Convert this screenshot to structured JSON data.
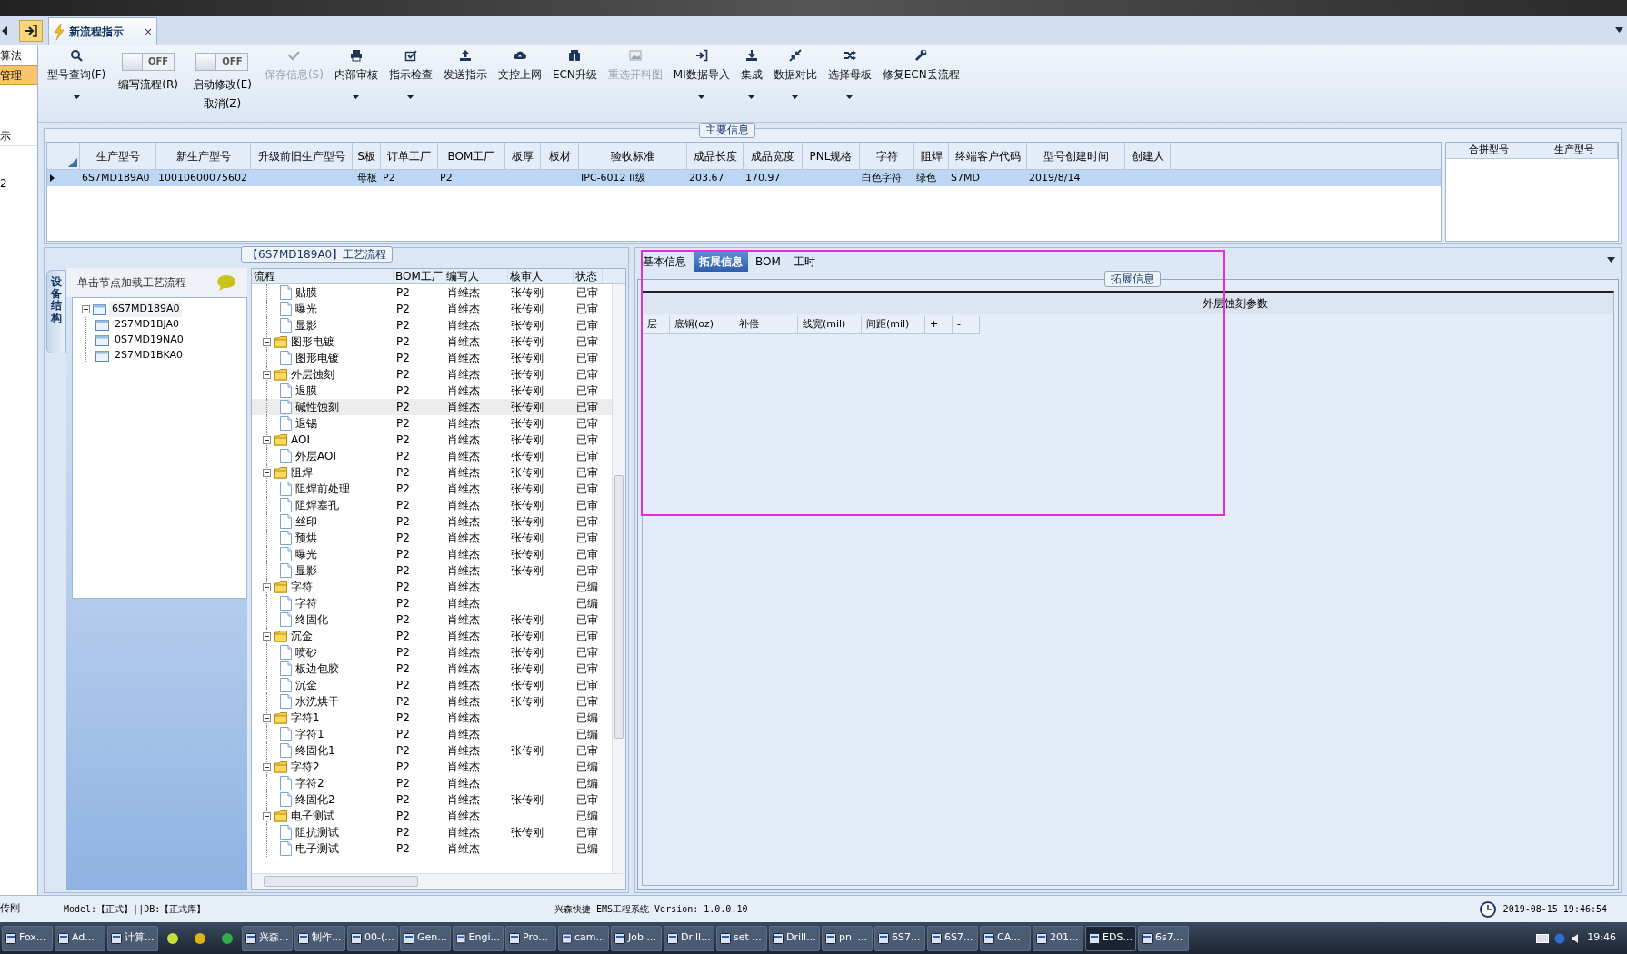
{
  "sidebar": {
    "items": [
      {
        "label": "算法",
        "selected": false
      },
      {
        "label": "管理",
        "selected": true
      },
      {
        "label": "示",
        "selected": false
      },
      {
        "label": "2",
        "selected": false
      }
    ]
  },
  "document_tab": {
    "title": "新流程指示",
    "close": "×"
  },
  "toolbar": {
    "items": [
      {
        "kind": "button",
        "label": "型号查询(F)",
        "dropdown": true,
        "disabled": false
      },
      {
        "kind": "toggle",
        "label": "编写流程(R)",
        "switch_text": "OFF",
        "on": false
      },
      {
        "kind": "toggle",
        "label": "启动修改(E)",
        "label2": "取消(Z)",
        "switch_text": "OFF",
        "on": false
      },
      {
        "kind": "button",
        "label": "保存信息(S)",
        "dropdown": false,
        "disabled": true
      },
      {
        "kind": "button",
        "label": "内部审核",
        "dropdown": true,
        "disabled": false
      },
      {
        "kind": "button",
        "label": "指示检查",
        "dropdown": true,
        "disabled": false
      },
      {
        "kind": "button",
        "label": "发送指示",
        "dropdown": false,
        "disabled": false
      },
      {
        "kind": "button",
        "label": "文控上网",
        "dropdown": false,
        "disabled": false
      },
      {
        "kind": "button",
        "label": "ECN升级",
        "dropdown": false,
        "disabled": false
      },
      {
        "kind": "button",
        "label": "重选开料图",
        "dropdown": false,
        "disabled": true
      },
      {
        "kind": "button",
        "label": "MI数据导入",
        "dropdown": true,
        "disabled": false
      },
      {
        "kind": "button",
        "label": "集成",
        "dropdown": true,
        "disabled": false
      },
      {
        "kind": "button",
        "label": "数据对比",
        "dropdown": true,
        "disabled": false
      },
      {
        "kind": "button",
        "label": "选择母板",
        "dropdown": true,
        "disabled": false
      },
      {
        "kind": "button",
        "label": "修复ECN丢流程",
        "dropdown": false,
        "disabled": false
      }
    ]
  },
  "main_info": {
    "title": "主要信息",
    "table": {
      "columns": [
        "生产型号",
        "新生产型号",
        "升级前旧生产型号",
        "S板",
        "订单工厂",
        "BOM工厂",
        "板厚",
        "板材",
        "验收标准",
        "成品长度",
        "成品宽度",
        "PNL规格",
        "字符",
        "阻焊",
        "终端客户代码",
        "型号创建时间",
        "创建人"
      ],
      "rows": [
        {
          "selected": true,
          "cells": [
            "6S7MD189A0",
            "10010600075602",
            null,
            "母板",
            "P2",
            "P2",
            null,
            null,
            "IPC-6012 II级",
            "203.67",
            "170.97",
            null,
            "白色字符",
            "绿色",
            "S7MD",
            "2019/8/14",
            null
          ]
        }
      ]
    },
    "side_table": {
      "columns": [
        "合拼型号",
        "生产型号"
      ]
    }
  },
  "structure_panel": {
    "vertical_tab": "设备结构",
    "hint": "单击节点加载工艺流程",
    "tree": [
      {
        "label": "6S7MD189A0",
        "expanded": true,
        "children": [
          {
            "label": "2S7MD1BJA0"
          },
          {
            "label": "0S7MD19NA0"
          },
          {
            "label": "2S7MD1BKA0"
          }
        ]
      }
    ]
  },
  "process_flow": {
    "title": "【6S7MD189A0】工艺流程",
    "columns": [
      "流程",
      "BOM工厂",
      "编写人",
      "核审人",
      "状态"
    ],
    "rows": [
      {
        "kind": "step",
        "name": "贴膜",
        "bom_factory": "P2",
        "writer": "肖维杰",
        "reviewer": "张传刚",
        "status": "已审",
        "selected": false
      },
      {
        "kind": "step",
        "name": "曝光",
        "bom_factory": "P2",
        "writer": "肖维杰",
        "reviewer": "张传刚",
        "status": "已审",
        "selected": false
      },
      {
        "kind": "step",
        "name": "显影",
        "bom_factory": "P2",
        "writer": "肖维杰",
        "reviewer": "张传刚",
        "status": "已审",
        "selected": false
      },
      {
        "kind": "folder",
        "name": "图形电镀",
        "bom_factory": "P2",
        "writer": "肖维杰",
        "reviewer": "张传刚",
        "status": "已审",
        "selected": false,
        "expanded": true,
        "children": [
          {
            "kind": "step",
            "name": "图形电镀",
            "bom_factory": "P2",
            "writer": "肖维杰",
            "reviewer": "张传刚",
            "status": "已审",
            "selected": false
          }
        ]
      },
      {
        "kind": "folder",
        "name": "外层蚀刻",
        "bom_factory": "P2",
        "writer": "肖维杰",
        "reviewer": "张传刚",
        "status": "已审",
        "selected": false,
        "expanded": true,
        "children": [
          {
            "kind": "step",
            "name": "退膜",
            "bom_factory": "P2",
            "writer": "肖维杰",
            "reviewer": "张传刚",
            "status": "已审",
            "selected": false
          },
          {
            "kind": "step",
            "name": "碱性蚀刻",
            "bom_factory": "P2",
            "writer": "肖维杰",
            "reviewer": "张传刚",
            "status": "已审",
            "selected": true
          },
          {
            "kind": "step",
            "name": "退锡",
            "bom_factory": "P2",
            "writer": "肖维杰",
            "reviewer": "张传刚",
            "status": "已审",
            "selected": false
          }
        ]
      },
      {
        "kind": "folder",
        "name": "AOI",
        "bom_factory": "P2",
        "writer": "肖维杰",
        "reviewer": "张传刚",
        "status": "已审",
        "selected": false,
        "expanded": true,
        "children": [
          {
            "kind": "step",
            "name": "外层AOI",
            "bom_factory": "P2",
            "writer": "肖维杰",
            "reviewer": "张传刚",
            "status": "已审",
            "selected": false
          }
        ]
      },
      {
        "kind": "folder",
        "name": "阻焊",
        "bom_factory": "P2",
        "writer": "肖维杰",
        "reviewer": "张传刚",
        "status": "已审",
        "selected": false,
        "expanded": true,
        "children": [
          {
            "kind": "step",
            "name": "阻焊前处理",
            "bom_factory": "P2",
            "writer": "肖维杰",
            "reviewer": "张传刚",
            "status": "已审",
            "selected": false
          },
          {
            "kind": "step",
            "name": "阻焊塞孔",
            "bom_factory": "P2",
            "writer": "肖维杰",
            "reviewer": "张传刚",
            "status": "已审",
            "selected": false
          },
          {
            "kind": "step",
            "name": "丝印",
            "bom_factory": "P2",
            "writer": "肖维杰",
            "reviewer": "张传刚",
            "status": "已审",
            "selected": false
          },
          {
            "kind": "step",
            "name": "预烘",
            "bom_factory": "P2",
            "writer": "肖维杰",
            "reviewer": "张传刚",
            "status": "已审",
            "selected": false
          },
          {
            "kind": "step",
            "name": "曝光",
            "bom_factory": "P2",
            "writer": "肖维杰",
            "reviewer": "张传刚",
            "status": "已审",
            "selected": false
          },
          {
            "kind": "step",
            "name": "显影",
            "bom_factory": "P2",
            "writer": "肖维杰",
            "reviewer": "张传刚",
            "status": "已审",
            "selected": false
          }
        ]
      },
      {
        "kind": "folder",
        "name": "字符",
        "bom_factory": "P2",
        "writer": "肖维杰",
        "status": "已编",
        "selected": false,
        "expanded": true,
        "children": [
          {
            "kind": "step",
            "name": "字符",
            "bom_factory": "P2",
            "writer": "肖维杰",
            "status": "已编",
            "selected": false
          },
          {
            "kind": "step",
            "name": "终固化",
            "bom_factory": "P2",
            "writer": "肖维杰",
            "reviewer": "张传刚",
            "status": "已审",
            "selected": false
          }
        ]
      },
      {
        "kind": "folder",
        "name": "沉金",
        "bom_factory": "P2",
        "writer": "肖维杰",
        "reviewer": "张传刚",
        "status": "已审",
        "selected": false,
        "expanded": true,
        "children": [
          {
            "kind": "step",
            "name": "喷砂",
            "bom_factory": "P2",
            "writer": "肖维杰",
            "reviewer": "张传刚",
            "status": "已审",
            "selected": false
          },
          {
            "kind": "step",
            "name": "板边包胶",
            "bom_factory": "P2",
            "writer": "肖维杰",
            "reviewer": "张传刚",
            "status": "已审",
            "selected": false
          },
          {
            "kind": "step",
            "name": "沉金",
            "bom_factory": "P2",
            "writer": "肖维杰",
            "reviewer": "张传刚",
            "status": "已审",
            "selected": false
          },
          {
            "kind": "step",
            "name": "水洗烘干",
            "bom_factory": "P2",
            "writer": "肖维杰",
            "reviewer": "张传刚",
            "status": "已审",
            "selected": false
          }
        ]
      },
      {
        "kind": "folder",
        "name": "字符1",
        "bom_factory": "P2",
        "writer": "肖维杰",
        "status": "已编",
        "selected": false,
        "expanded": true,
        "children": [
          {
            "kind": "step",
            "name": "字符1",
            "bom_factory": "P2",
            "writer": "肖维杰",
            "status": "已编",
            "selected": false
          },
          {
            "kind": "step",
            "name": "终固化1",
            "bom_factory": "P2",
            "writer": "肖维杰",
            "reviewer": "张传刚",
            "status": "已审",
            "selected": false
          }
        ]
      },
      {
        "kind": "folder",
        "name": "字符2",
        "bom_factory": "P2",
        "writer": "肖维杰",
        "status": "已编",
        "selected": false,
        "expanded": true,
        "children": [
          {
            "kind": "step",
            "name": "字符2",
            "bom_factory": "P2",
            "writer": "肖维杰",
            "status": "已编",
            "selected": false
          },
          {
            "kind": "step",
            "name": "终固化2",
            "bom_factory": "P2",
            "writer": "肖维杰",
            "reviewer": "张传刚",
            "status": "已审",
            "selected": false
          }
        ]
      },
      {
        "kind": "folder",
        "name": "电子测试",
        "bom_factory": "P2",
        "writer": "肖维杰",
        "status": "已编",
        "selected": false,
        "expanded": true,
        "children": [
          {
            "kind": "step",
            "name": "阻抗测试",
            "bom_factory": "P2",
            "writer": "肖维杰",
            "reviewer": "张传刚",
            "status": "已审",
            "selected": false
          },
          {
            "kind": "step",
            "name": "电子测试",
            "bom_factory": "P2",
            "writer": "肖维杰",
            "status": "已编",
            "selected": false
          }
        ]
      }
    ]
  },
  "detail_panel": {
    "tabs": [
      {
        "label": "基本信息",
        "selected": false
      },
      {
        "label": "拓展信息",
        "selected": true
      },
      {
        "label": "BOM",
        "selected": false
      },
      {
        "label": "工时",
        "selected": false
      }
    ],
    "group_title": "拓展信息",
    "grid_title": "外层蚀刻参数",
    "columns": [
      "层",
      "底铜(oz)",
      "补偿",
      "线宽(mil)",
      "间距(mil)",
      "+",
      "-"
    ]
  },
  "status_bar": {
    "user": "传刚",
    "model": "Model:【正式】||DB:【正式库】",
    "app": "兴森快捷 EMS工程系统 Version: 1.0.0.10",
    "datetime": "2019-08-15 19:46:54"
  },
  "taskbar": {
    "items": [
      {
        "kind": "app",
        "label": "Fox...",
        "selected": false
      },
      {
        "kind": "app",
        "label": "Ad...",
        "selected": false
      },
      {
        "kind": "app",
        "label": "计算...",
        "selected": false
      },
      {
        "kind": "icon_only",
        "selected": false
      },
      {
        "kind": "icon_only",
        "selected": false
      },
      {
        "kind": "icon_only",
        "selected": false
      },
      {
        "kind": "app",
        "label": "兴森...",
        "selected": false
      },
      {
        "kind": "app",
        "label": "制作...",
        "selected": false
      },
      {
        "kind": "app",
        "label": "00-(...",
        "selected": false
      },
      {
        "kind": "app",
        "label": "Gen...",
        "selected": false
      },
      {
        "kind": "app",
        "label": "Engi...",
        "selected": false
      },
      {
        "kind": "app",
        "label": "Pro...",
        "selected": false
      },
      {
        "kind": "app",
        "label": "cam...",
        "selected": false
      },
      {
        "kind": "app",
        "label": "Job ...",
        "selected": false
      },
      {
        "kind": "app",
        "label": "Drill...",
        "selected": false
      },
      {
        "kind": "app",
        "label": "set ...",
        "selected": false
      },
      {
        "kind": "app",
        "label": "Drill...",
        "selected": false
      },
      {
        "kind": "app",
        "label": "pnl ...",
        "selected": false
      },
      {
        "kind": "app",
        "label": "6S7...",
        "selected": false
      },
      {
        "kind": "app",
        "label": "6S7...",
        "selected": false
      },
      {
        "kind": "app",
        "label": "CA...",
        "selected": false
      },
      {
        "kind": "app",
        "label": "201...",
        "selected": false
      },
      {
        "kind": "app",
        "label": "EDS...",
        "selected": true
      },
      {
        "kind": "app",
        "label": "6s7...",
        "selected": false
      }
    ],
    "clock": "19:46"
  }
}
